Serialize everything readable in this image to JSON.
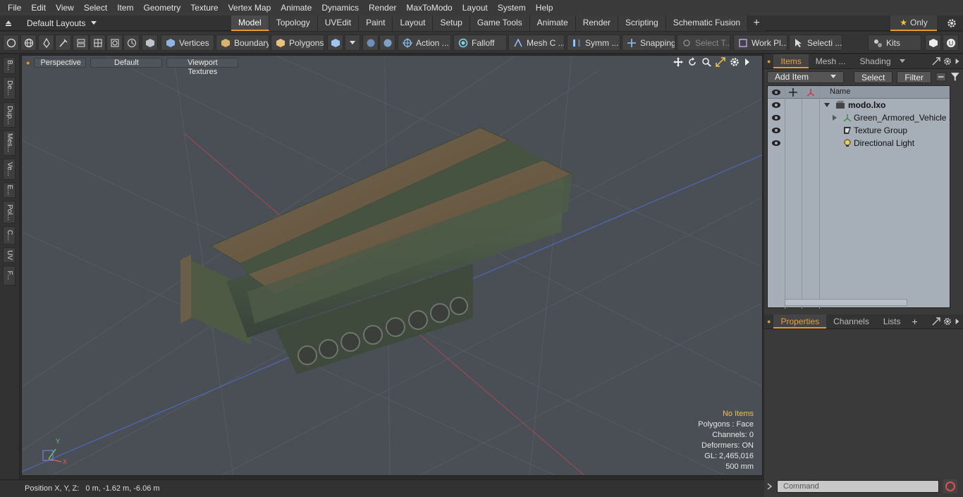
{
  "menu": [
    "File",
    "Edit",
    "View",
    "Select",
    "Item",
    "Geometry",
    "Texture",
    "Vertex Map",
    "Animate",
    "Dynamics",
    "Render",
    "MaxToModo",
    "Layout",
    "System",
    "Help"
  ],
  "layout_selector": "Default Layouts",
  "tabs": [
    {
      "label": "Model",
      "active": true
    },
    {
      "label": "Topology"
    },
    {
      "label": "UVEdit"
    },
    {
      "label": "Paint"
    },
    {
      "label": "Layout"
    },
    {
      "label": "Setup"
    },
    {
      "label": "Game Tools"
    },
    {
      "label": "Animate"
    },
    {
      "label": "Render"
    },
    {
      "label": "Scripting"
    },
    {
      "label": "Schematic Fusion"
    }
  ],
  "only_label": "Only",
  "toolbar": {
    "vertices": "Vertices",
    "boundary": "Boundary",
    "polygons": "Polygons",
    "action": "Action ...",
    "falloff": "Falloff",
    "mesh_c": "Mesh C ...",
    "symm": "Symm ...",
    "snapping": "Snapping",
    "select_t": "Select T...",
    "work_pl": "Work Pl...",
    "selecti": "Selecti ...",
    "kits": "Kits"
  },
  "left_tabs": [
    "B...",
    "De...",
    "Dup...",
    "Mes...",
    "Ve...",
    "E...",
    "Pol...",
    "C...",
    "UV",
    "F..."
  ],
  "viewport": {
    "view_mode": "Perspective",
    "shading": "Default",
    "textures": "Viewport Textures",
    "info": {
      "selection": "No Items",
      "polygons": "Polygons : Face",
      "channels": "Channels: 0",
      "deformers": "Deformers: ON",
      "gl": "GL: 2,465,016",
      "scale": "500 mm"
    },
    "axis_x": "X",
    "axis_y": "Y"
  },
  "status": {
    "position": "Position X, Y, Z:   0 m, -1.62 m, -6.06 m"
  },
  "items_panel": {
    "tabs": [
      "Items",
      "Mesh ...",
      "Shading"
    ],
    "add_item": "Add Item",
    "select": "Select",
    "filter": "Filter",
    "column_name": "Name",
    "tree": [
      {
        "label": "modo.lxo"
      },
      {
        "label": "Green_Armored_Vehicle ..."
      },
      {
        "label": "Texture Group"
      },
      {
        "label": "Directional Light"
      }
    ]
  },
  "properties_panel": {
    "tabs": [
      "Properties",
      "Channels",
      "Lists"
    ]
  },
  "command": {
    "placeholder": "Command"
  },
  "colors": {
    "accent": "#e59a2e",
    "viewport_bg": "#4a4f55",
    "tree_bg": "#a6aeb8"
  }
}
